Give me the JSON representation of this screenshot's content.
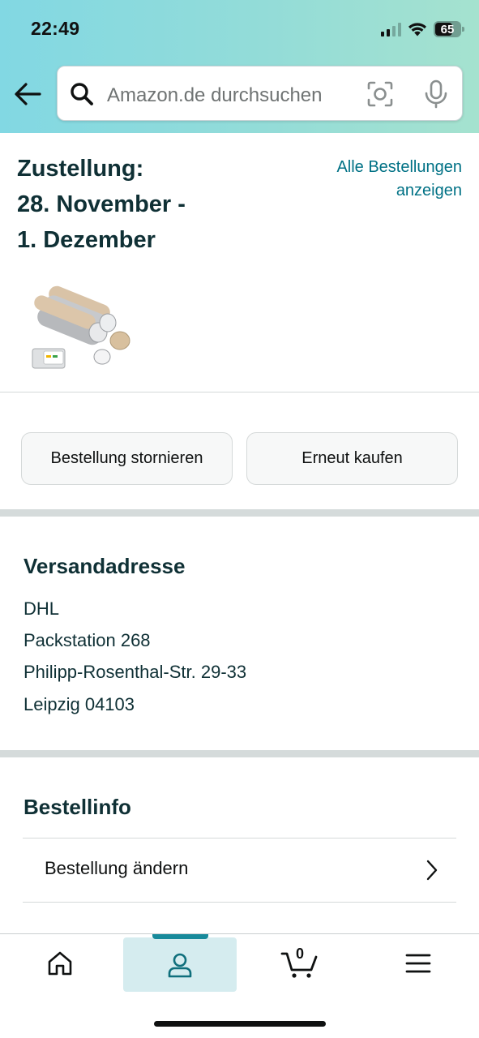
{
  "status_bar": {
    "time": "22:49",
    "battery": "65"
  },
  "search": {
    "placeholder": "Amazon.de durchsuchen"
  },
  "order": {
    "delivery_line1": "Zustellung:",
    "delivery_line2": "28. November -",
    "delivery_line3": "1. Dezember",
    "all_orders_line1": "Alle Bestellungen",
    "all_orders_line2": "anzeigen"
  },
  "actions": {
    "cancel_label": "Bestellung stornieren",
    "rebuy_label": "Erneut kaufen"
  },
  "shipping": {
    "title": "Versandadresse",
    "lines": [
      "DHL",
      "Packstation 268",
      "Philipp-Rosenthal-Str. 29-33",
      "Leipzig 04103"
    ]
  },
  "order_info": {
    "title": "Bestellinfo",
    "change_order_label": "Bestellung ändern"
  },
  "tabbar": {
    "cart_count": "0",
    "active_tab": "you"
  },
  "colors": {
    "link": "#007185",
    "heading": "#0f3035",
    "active_tab_bg": "#d5ecef",
    "active_tab_indicator": "#178a9b"
  },
  "icons": [
    "back-arrow-icon",
    "search-icon",
    "camera-icon",
    "microphone-icon",
    "chevron-right-icon",
    "home-icon",
    "account-icon",
    "cart-icon",
    "menu-icon"
  ]
}
